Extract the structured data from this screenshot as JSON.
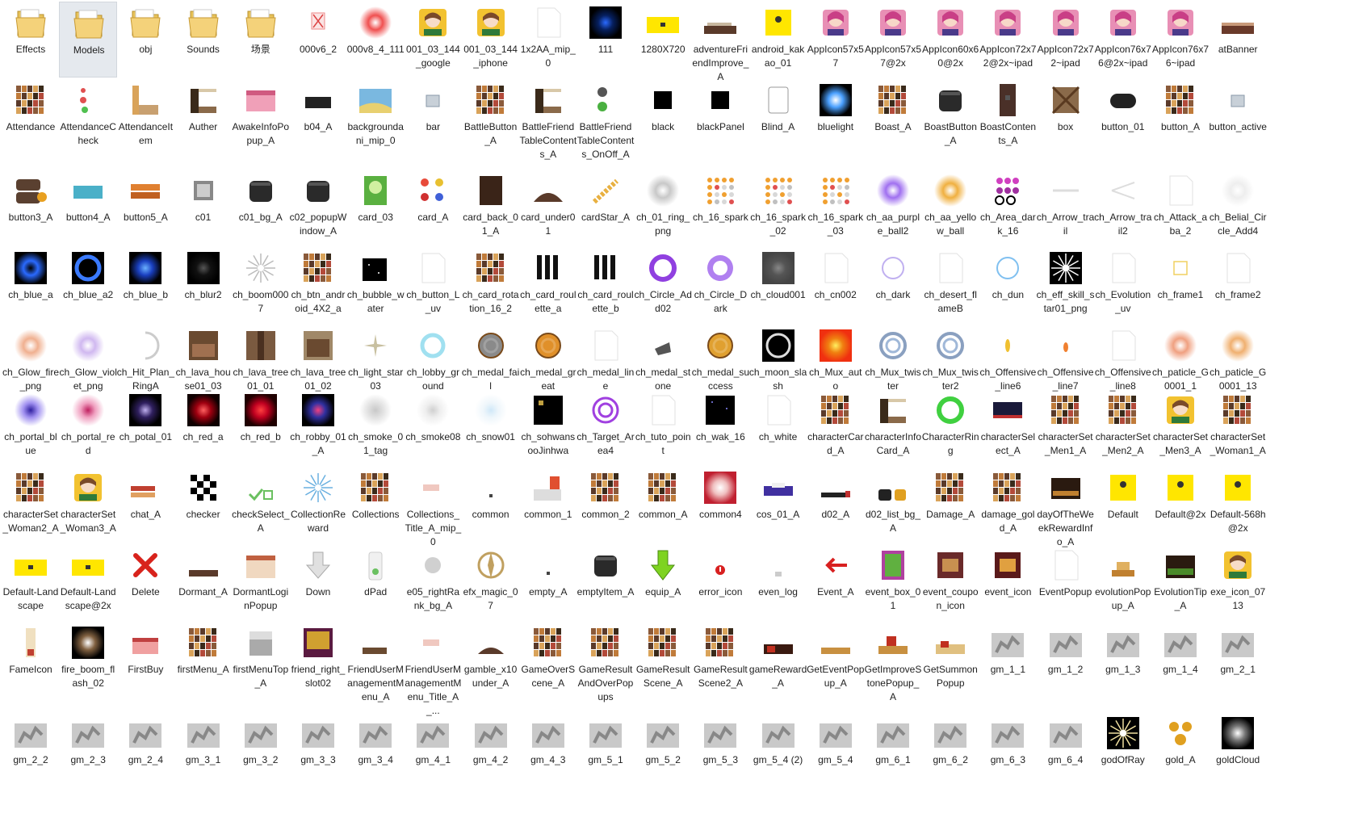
{
  "view": "large-icons",
  "selected_item": "Models",
  "items": [
    {
      "name": "Effects",
      "icon": "folder-icon"
    },
    {
      "name": "Models",
      "icon": "folder-icon"
    },
    {
      "name": "obj",
      "icon": "folder-icon"
    },
    {
      "name": "Sounds",
      "icon": "folder-icon"
    },
    {
      "name": "场景",
      "icon": "folder-icon"
    },
    {
      "name": "000v6_2",
      "icon": "image-icon"
    },
    {
      "name": "000v8_4_111",
      "icon": "image-icon"
    },
    {
      "name": "001_03_144_google",
      "icon": "image-icon"
    },
    {
      "name": "001_03_144_iphone",
      "icon": "image-icon"
    },
    {
      "name": "1x2AA_mip_0",
      "icon": "image-icon"
    },
    {
      "name": "111",
      "icon": "image-icon"
    },
    {
      "name": "1280X720",
      "icon": "image-icon"
    },
    {
      "name": "adventureFriendImprove_A",
      "icon": "image-icon"
    },
    {
      "name": "android_kakao_01",
      "icon": "image-icon"
    },
    {
      "name": "AppIcon57x57",
      "icon": "image-icon"
    },
    {
      "name": "AppIcon57x57@2x",
      "icon": "image-icon"
    },
    {
      "name": "AppIcon60x60@2x",
      "icon": "image-icon"
    },
    {
      "name": "AppIcon72x72@2x~ipad",
      "icon": "image-icon"
    },
    {
      "name": "AppIcon72x72~ipad",
      "icon": "image-icon"
    },
    {
      "name": "AppIcon76x76@2x~ipad",
      "icon": "image-icon"
    },
    {
      "name": "AppIcon76x76~ipad",
      "icon": "image-icon"
    },
    {
      "name": "atBanner",
      "icon": "image-icon"
    },
    {
      "name": "Attendance",
      "icon": "image-icon"
    },
    {
      "name": "AttendanceCheck",
      "icon": "image-icon"
    },
    {
      "name": "AttendanceItem",
      "icon": "image-icon"
    },
    {
      "name": "Auther",
      "icon": "image-icon"
    },
    {
      "name": "AwakeInfoPopup_A",
      "icon": "image-icon"
    },
    {
      "name": "b04_A",
      "icon": "image-icon"
    },
    {
      "name": "backgroundani_mip_0",
      "icon": "image-icon"
    },
    {
      "name": "bar",
      "icon": "image-icon"
    },
    {
      "name": "BattleButton_A",
      "icon": "image-icon"
    },
    {
      "name": "BattleFriendTableContents_A",
      "icon": "image-icon"
    },
    {
      "name": "BattleFriendTableContents_OnOff_A",
      "icon": "image-icon"
    },
    {
      "name": "black",
      "icon": "image-icon"
    },
    {
      "name": "blackPanel",
      "icon": "image-icon"
    },
    {
      "name": "Blind_A",
      "icon": "image-icon"
    },
    {
      "name": "bluelight",
      "icon": "image-icon"
    },
    {
      "name": "Boast_A",
      "icon": "image-icon"
    },
    {
      "name": "BoastButton_A",
      "icon": "image-icon"
    },
    {
      "name": "BoastContents_A",
      "icon": "image-icon"
    },
    {
      "name": "box",
      "icon": "image-icon"
    },
    {
      "name": "button_01",
      "icon": "image-icon"
    },
    {
      "name": "button_A",
      "icon": "image-icon"
    },
    {
      "name": "button_active",
      "icon": "image-icon"
    },
    {
      "name": "button3_A",
      "icon": "image-icon"
    },
    {
      "name": "button4_A",
      "icon": "image-icon"
    },
    {
      "name": "button5_A",
      "icon": "image-icon"
    },
    {
      "name": "c01",
      "icon": "image-icon"
    },
    {
      "name": "c01_bg_A",
      "icon": "image-icon"
    },
    {
      "name": "c02_popupWindow_A",
      "icon": "image-icon"
    },
    {
      "name": "card_03",
      "icon": "image-icon"
    },
    {
      "name": "card_A",
      "icon": "image-icon"
    },
    {
      "name": "card_back_01_A",
      "icon": "image-icon"
    },
    {
      "name": "card_under01",
      "icon": "image-icon"
    },
    {
      "name": "cardStar_A",
      "icon": "image-icon"
    },
    {
      "name": "ch_01_ring_png",
      "icon": "image-icon"
    },
    {
      "name": "ch_16_spark",
      "icon": "image-icon"
    },
    {
      "name": "ch_16_spark_02",
      "icon": "image-icon"
    },
    {
      "name": "ch_16_spark_03",
      "icon": "image-icon"
    },
    {
      "name": "ch_aa_purple_ball2",
      "icon": "image-icon"
    },
    {
      "name": "ch_aa_yellow_ball",
      "icon": "image-icon"
    },
    {
      "name": "ch_Area_dark_16",
      "icon": "image-icon"
    },
    {
      "name": "ch_Arrow_trail",
      "icon": "image-icon"
    },
    {
      "name": "ch_Arrow_trail2",
      "icon": "image-icon"
    },
    {
      "name": "ch_Attack_aba_2",
      "icon": "image-icon"
    },
    {
      "name": "ch_Belial_Circle_Add4",
      "icon": "image-icon"
    },
    {
      "name": "ch_blue_a",
      "icon": "image-icon"
    },
    {
      "name": "ch_blue_a2",
      "icon": "image-icon"
    },
    {
      "name": "ch_blue_b",
      "icon": "image-icon"
    },
    {
      "name": "ch_blur2",
      "icon": "image-icon"
    },
    {
      "name": "ch_boom0007",
      "icon": "image-icon"
    },
    {
      "name": "ch_btn_android_4X2_a",
      "icon": "image-icon"
    },
    {
      "name": "ch_bubble_water",
      "icon": "image-icon"
    },
    {
      "name": "ch_button_L_uv",
      "icon": "image-icon"
    },
    {
      "name": "ch_card_rotation_16_2",
      "icon": "image-icon"
    },
    {
      "name": "ch_card_roulette_a",
      "icon": "image-icon"
    },
    {
      "name": "ch_card_roulette_b",
      "icon": "image-icon"
    },
    {
      "name": "ch_Circle_Add02",
      "icon": "image-icon"
    },
    {
      "name": "ch_Circle_Dark",
      "icon": "image-icon"
    },
    {
      "name": "ch_cloud001",
      "icon": "image-icon"
    },
    {
      "name": "ch_cn002",
      "icon": "image-icon"
    },
    {
      "name": "ch_dark",
      "icon": "image-icon"
    },
    {
      "name": "ch_desert_flameB",
      "icon": "image-icon"
    },
    {
      "name": "ch_dun",
      "icon": "image-icon"
    },
    {
      "name": "ch_eff_skill_star01_png",
      "icon": "image-icon"
    },
    {
      "name": "ch_Evolution_uv",
      "icon": "image-icon"
    },
    {
      "name": "ch_frame1",
      "icon": "image-icon"
    },
    {
      "name": "ch_frame2",
      "icon": "image-icon"
    },
    {
      "name": "ch_Glow_fire_png",
      "icon": "image-icon"
    },
    {
      "name": "ch_Glow_violet_png",
      "icon": "image-icon"
    },
    {
      "name": "ch_Hit_Plan_RingA",
      "icon": "image-icon"
    },
    {
      "name": "ch_lava_house01_03",
      "icon": "image-icon"
    },
    {
      "name": "ch_lava_tree01_01",
      "icon": "image-icon"
    },
    {
      "name": "ch_lava_tree01_02",
      "icon": "image-icon"
    },
    {
      "name": "ch_light_star03",
      "icon": "image-icon"
    },
    {
      "name": "ch_lobby_ground",
      "icon": "image-icon"
    },
    {
      "name": "ch_medal_fail",
      "icon": "image-icon"
    },
    {
      "name": "ch_medal_great",
      "icon": "image-icon"
    },
    {
      "name": "ch_medal_line",
      "icon": "image-icon"
    },
    {
      "name": "ch_medal_stone",
      "icon": "image-icon"
    },
    {
      "name": "ch_medal_success",
      "icon": "image-icon"
    },
    {
      "name": "ch_moon_slash",
      "icon": "image-icon"
    },
    {
      "name": "ch_Mux_auto",
      "icon": "image-icon"
    },
    {
      "name": "ch_Mux_twister",
      "icon": "image-icon"
    },
    {
      "name": "ch_Mux_twister2",
      "icon": "image-icon"
    },
    {
      "name": "ch_Offensive_line6",
      "icon": "image-icon"
    },
    {
      "name": "ch_Offensive_line7",
      "icon": "image-icon"
    },
    {
      "name": "ch_Offensive_line8",
      "icon": "image-icon"
    },
    {
      "name": "ch_paticle_G0001_1",
      "icon": "image-icon"
    },
    {
      "name": "ch_paticle_G0001_13",
      "icon": "image-icon"
    },
    {
      "name": "ch_portal_blue",
      "icon": "image-icon"
    },
    {
      "name": "ch_portal_red",
      "icon": "image-icon"
    },
    {
      "name": "ch_potal_01",
      "icon": "image-icon"
    },
    {
      "name": "ch_red_a",
      "icon": "image-icon"
    },
    {
      "name": "ch_red_b",
      "icon": "image-icon"
    },
    {
      "name": "ch_robby_01_A",
      "icon": "image-icon"
    },
    {
      "name": "ch_smoke_01_tag",
      "icon": "image-icon"
    },
    {
      "name": "ch_smoke08",
      "icon": "image-icon"
    },
    {
      "name": "ch_snow01",
      "icon": "image-icon"
    },
    {
      "name": "ch_sohwansooJinhwa",
      "icon": "image-icon"
    },
    {
      "name": "ch_Target_Area4",
      "icon": "image-icon"
    },
    {
      "name": "ch_tuto_point",
      "icon": "image-icon"
    },
    {
      "name": "ch_wak_16",
      "icon": "image-icon"
    },
    {
      "name": "ch_white",
      "icon": "image-icon"
    },
    {
      "name": "characterCard_A",
      "icon": "image-icon"
    },
    {
      "name": "characterInfoCard_A",
      "icon": "image-icon"
    },
    {
      "name": "CharacterRing",
      "icon": "image-icon"
    },
    {
      "name": "characterSelect_A",
      "icon": "image-icon"
    },
    {
      "name": "characterSet_Men1_A",
      "icon": "image-icon"
    },
    {
      "name": "characterSet_Men2_A",
      "icon": "image-icon"
    },
    {
      "name": "characterSet_Men3_A",
      "icon": "image-icon"
    },
    {
      "name": "characterSet_Woman1_A",
      "icon": "image-icon"
    },
    {
      "name": "characterSet_Woman2_A",
      "icon": "image-icon"
    },
    {
      "name": "characterSet_Woman3_A",
      "icon": "image-icon"
    },
    {
      "name": "chat_A",
      "icon": "image-icon"
    },
    {
      "name": "checker",
      "icon": "image-icon"
    },
    {
      "name": "checkSelect_A",
      "icon": "image-icon"
    },
    {
      "name": "CollectionReward",
      "icon": "image-icon"
    },
    {
      "name": "Collections",
      "icon": "image-icon"
    },
    {
      "name": "Collections_Title_A_mip_0",
      "icon": "image-icon"
    },
    {
      "name": "common",
      "icon": "image-icon"
    },
    {
      "name": "common_1",
      "icon": "image-icon"
    },
    {
      "name": "common_2",
      "icon": "image-icon"
    },
    {
      "name": "common_A",
      "icon": "image-icon"
    },
    {
      "name": "common4",
      "icon": "image-icon"
    },
    {
      "name": "cos_01_A",
      "icon": "image-icon"
    },
    {
      "name": "d02_A",
      "icon": "image-icon"
    },
    {
      "name": "d02_list_bg_A",
      "icon": "image-icon"
    },
    {
      "name": "Damage_A",
      "icon": "image-icon"
    },
    {
      "name": "damage_gold_A",
      "icon": "image-icon"
    },
    {
      "name": "dayOfTheWeekRewardInfo_A",
      "icon": "image-icon"
    },
    {
      "name": "Default",
      "icon": "image-icon"
    },
    {
      "name": "Default@2x",
      "icon": "image-icon"
    },
    {
      "name": "Default-568h@2x",
      "icon": "image-icon"
    },
    {
      "name": "Default-Landscape",
      "icon": "image-icon"
    },
    {
      "name": "Default-Landscape@2x",
      "icon": "image-icon"
    },
    {
      "name": "Delete",
      "icon": "image-icon"
    },
    {
      "name": "Dormant_A",
      "icon": "image-icon"
    },
    {
      "name": "DormantLoginPopup",
      "icon": "image-icon"
    },
    {
      "name": "Down",
      "icon": "image-icon"
    },
    {
      "name": "dPad",
      "icon": "image-icon"
    },
    {
      "name": "e05_rightRank_bg_A",
      "icon": "image-icon"
    },
    {
      "name": "efx_magic_07",
      "icon": "image-icon"
    },
    {
      "name": "empty_A",
      "icon": "image-icon"
    },
    {
      "name": "emptyItem_A",
      "icon": "image-icon"
    },
    {
      "name": "equip_A",
      "icon": "image-icon"
    },
    {
      "name": "error_icon",
      "icon": "image-icon"
    },
    {
      "name": "even_log",
      "icon": "image-icon"
    },
    {
      "name": "Event_A",
      "icon": "image-icon"
    },
    {
      "name": "event_box_01",
      "icon": "image-icon"
    },
    {
      "name": "event_coupon_icon",
      "icon": "image-icon"
    },
    {
      "name": "event_icon",
      "icon": "image-icon"
    },
    {
      "name": "EventPopup",
      "icon": "image-icon"
    },
    {
      "name": "evolutionPopup_A",
      "icon": "image-icon"
    },
    {
      "name": "EvolutionTip_A",
      "icon": "image-icon"
    },
    {
      "name": "exe_icon_0713",
      "icon": "image-icon"
    },
    {
      "name": "FameIcon",
      "icon": "image-icon"
    },
    {
      "name": "fire_boom_flash_02",
      "icon": "image-icon"
    },
    {
      "name": "FirstBuy",
      "icon": "image-icon"
    },
    {
      "name": "firstMenu_A",
      "icon": "image-icon"
    },
    {
      "name": "firstMenuTop_A",
      "icon": "image-icon"
    },
    {
      "name": "friend_right_slot02",
      "icon": "image-icon"
    },
    {
      "name": "FriendUserManagementMenu_A",
      "icon": "image-icon"
    },
    {
      "name": "FriendUserManagementMenu_Title_A_...",
      "icon": "image-icon"
    },
    {
      "name": "gamble_x10under_A",
      "icon": "image-icon"
    },
    {
      "name": "GameOverScene_A",
      "icon": "image-icon"
    },
    {
      "name": "GameResultAndOverPopups",
      "icon": "image-icon"
    },
    {
      "name": "GameResultScene_A",
      "icon": "image-icon"
    },
    {
      "name": "GameResultScene2_A",
      "icon": "image-icon"
    },
    {
      "name": "gameReward_A",
      "icon": "image-icon"
    },
    {
      "name": "GetEventPopup_A",
      "icon": "image-icon"
    },
    {
      "name": "GetImproveStonePopup_A",
      "icon": "image-icon"
    },
    {
      "name": "GetSummonPopup",
      "icon": "image-icon"
    },
    {
      "name": "gm_1_1",
      "icon": "image-icon"
    },
    {
      "name": "gm_1_2",
      "icon": "image-icon"
    },
    {
      "name": "gm_1_3",
      "icon": "image-icon"
    },
    {
      "name": "gm_1_4",
      "icon": "image-icon"
    },
    {
      "name": "gm_2_1",
      "icon": "image-icon"
    },
    {
      "name": "gm_2_2",
      "icon": "image-icon"
    },
    {
      "name": "gm_2_3",
      "icon": "image-icon"
    },
    {
      "name": "gm_2_4",
      "icon": "image-icon"
    },
    {
      "name": "gm_3_1",
      "icon": "image-icon"
    },
    {
      "name": "gm_3_2",
      "icon": "image-icon"
    },
    {
      "name": "gm_3_3",
      "icon": "image-icon"
    },
    {
      "name": "gm_3_4",
      "icon": "image-icon"
    },
    {
      "name": "gm_4_1",
      "icon": "image-icon"
    },
    {
      "name": "gm_4_2",
      "icon": "image-icon"
    },
    {
      "name": "gm_4_3",
      "icon": "image-icon"
    },
    {
      "name": "gm_5_1",
      "icon": "image-icon"
    },
    {
      "name": "gm_5_2",
      "icon": "image-icon"
    },
    {
      "name": "gm_5_3",
      "icon": "image-icon"
    },
    {
      "name": "gm_5_4 (2)",
      "icon": "image-icon"
    },
    {
      "name": "gm_5_4",
      "icon": "image-icon"
    },
    {
      "name": "gm_6_1",
      "icon": "image-icon"
    },
    {
      "name": "gm_6_2",
      "icon": "image-icon"
    },
    {
      "name": "gm_6_3",
      "icon": "image-icon"
    },
    {
      "name": "gm_6_4",
      "icon": "image-icon"
    },
    {
      "name": "godOfRay",
      "icon": "image-icon"
    },
    {
      "name": "gold_A",
      "icon": "image-icon"
    },
    {
      "name": "goldCloud",
      "icon": "image-icon"
    }
  ]
}
